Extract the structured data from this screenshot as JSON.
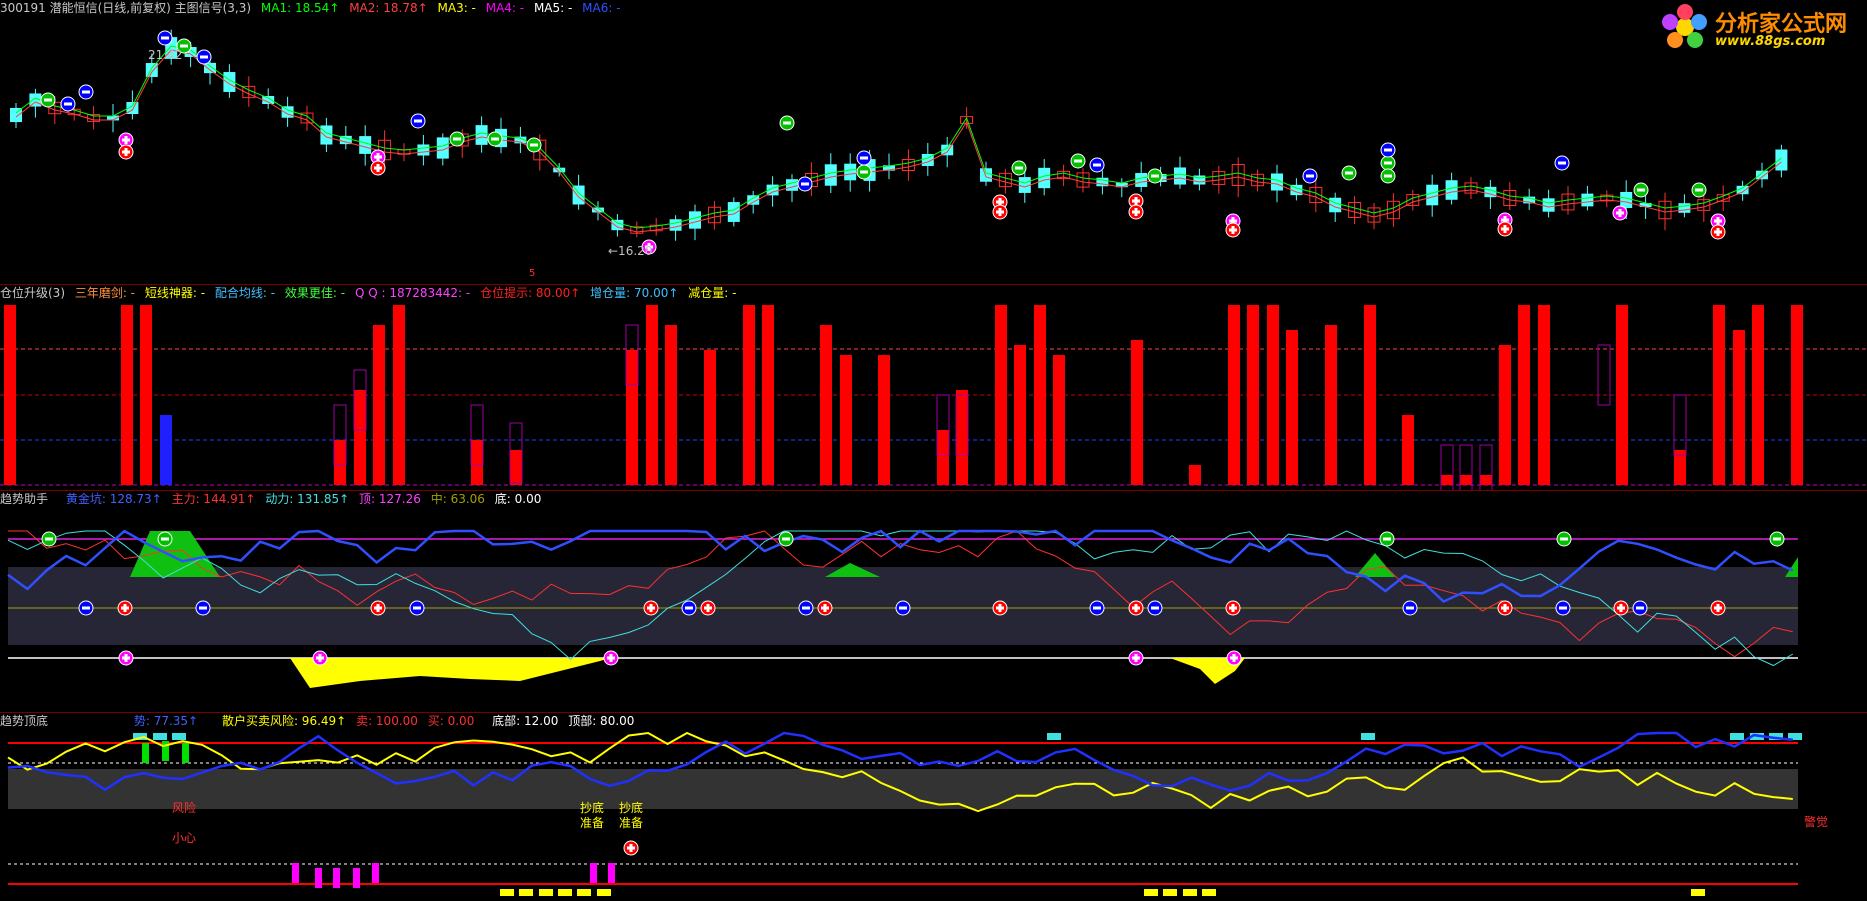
{
  "main": {
    "title": "300191 潜能恒信(日线,前复权) 主图信号(3,3)",
    "ma": [
      {
        "label": "MA1: 18.54↑",
        "color": "#00ff00"
      },
      {
        "label": "MA2: 18.78↑",
        "color": "#ff4040"
      },
      {
        "label": "MA3: -",
        "color": "#ffff00"
      },
      {
        "label": "MA4: -",
        "color": "#ff00ff"
      },
      {
        "label": "MA5: -",
        "color": "#ffffff"
      },
      {
        "label": "MA6: -",
        "color": "#0000ff"
      }
    ],
    "high_mark": "21.42",
    "low_mark": "←16.20",
    "marker5": "5"
  },
  "logo": {
    "name": "分析家公式网",
    "url": "www.88gs.com"
  },
  "panel2": {
    "title": "仓位升级(3)",
    "items": [
      {
        "label": "三年磨剑: -",
        "color": "#ff9040"
      },
      {
        "label": "短线神器: -",
        "color": "#ffff00"
      },
      {
        "label": "配合均线: -",
        "color": "#40c0ff"
      },
      {
        "label": "效果更佳: -",
        "color": "#40ff40"
      },
      {
        "label": "Q Q : 187283442: -",
        "color": "#ff40ff"
      },
      {
        "label": "仓位提示: 80.00↑",
        "color": "#ff2020"
      },
      {
        "label": "增仓量: 70.00↑",
        "color": "#40c0ff"
      },
      {
        "label": "减仓量: -",
        "color": "#ffff00"
      }
    ]
  },
  "panel3": {
    "title": "趋势助手",
    "items": [
      {
        "label": "黄金坑: 128.73↑",
        "color": "#4060ff"
      },
      {
        "label": "主力: 144.91↑",
        "color": "#ff3030"
      },
      {
        "label": "动力: 131.85↑",
        "color": "#40e0e0"
      },
      {
        "label": "顶: 127.26",
        "color": "#ff40ff"
      },
      {
        "label": "中: 63.06",
        "color": "#a0a000"
      },
      {
        "label": "底: 0.00",
        "color": "#ffffff"
      }
    ]
  },
  "panel4": {
    "title": "趋势顶底",
    "items": [
      {
        "label": "势: 77.35↑",
        "color": "#4060ff"
      },
      {
        "label": "散户买卖风险: 96.49↑",
        "color": "#ffff00"
      },
      {
        "label": "卖: 100.00",
        "color": "#ff3030"
      },
      {
        "label": "买: 0.00",
        "color": "#ff3030"
      },
      {
        "label": "底部: 12.00",
        "color": "#ffffff"
      },
      {
        "label": "顶部: 80.00",
        "color": "#ffffff"
      }
    ],
    "text_risk": "风险",
    "text_careful": "小心",
    "text_bottom1": "抄底",
    "text_ready1": "准备",
    "text_bottom2": "抄底",
    "text_ready2": "准备",
    "text_alert": "警觉"
  },
  "colors": {
    "up": "#ff3030",
    "down": "#54ffff",
    "bg": "#000000"
  }
}
